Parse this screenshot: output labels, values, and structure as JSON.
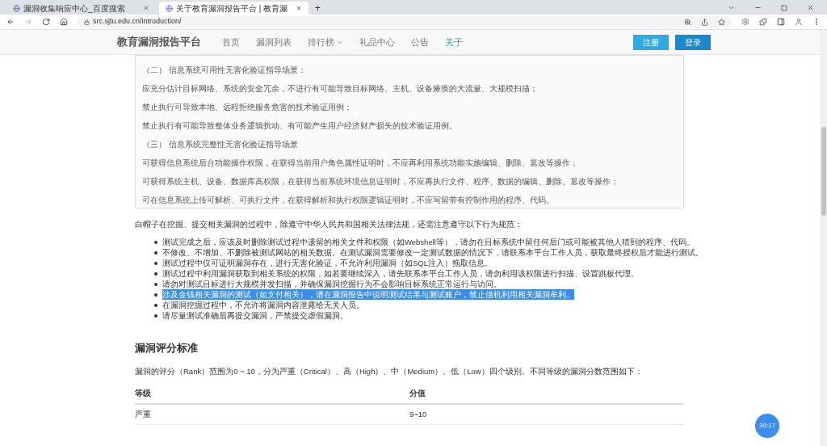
{
  "browser": {
    "tabs": [
      {
        "title": "漏洞收集响应中心_百度搜索",
        "selected": false
      },
      {
        "title": "关于教育漏洞报告平台 | 教育漏",
        "selected": true
      }
    ],
    "new_tab": "+",
    "url": "src.sjtu.edu.cn/introduction/"
  },
  "site_nav": {
    "brand": "教育漏洞报告平台",
    "items": [
      {
        "label": "首页",
        "selected": false,
        "dropdown": false
      },
      {
        "label": "漏洞列表",
        "selected": false,
        "dropdown": false
      },
      {
        "label": "排行榜",
        "selected": false,
        "dropdown": true
      },
      {
        "label": "礼品中心",
        "selected": false,
        "dropdown": false
      },
      {
        "label": "公告",
        "selected": false,
        "dropdown": false
      },
      {
        "label": "关于",
        "selected": true,
        "dropdown": false
      }
    ],
    "register": "注册",
    "login": "登录"
  },
  "document_image": {
    "lines": [
      "（二） 信息系统可用性无害化验证指导场景：",
      "应充分估计目标网络、系统的安全冗余，不进行有可能导致目标网络、主机、设备瘫痪的大流量、大规模扫描；",
      "禁止执行可导致本地、远程拒绝服务危害的技术验证用例；",
      "禁止执行有可能导致整体业务逻辑扰动、有可能产生用户经济财产损失的技术验证用例。",
      "（三） 信息系统完整性无害化验证指导场景",
      "可获得信息系统后台功能操作权限，在获得当前用户角色属性证明时，不应再利用系统功能实施编辑、删除、篡改等操作；",
      "可获得系统主机、设备、数据库高权限，在获得当前系统环境信息证明时，不应再执行文件、程序、数据的编辑、删除、篡改等操作；",
      "可在信息系统上传可解析、可执行文件，在获得解析和执行权限逻辑证明时，不应写留带有控制作用的程序、代码。"
    ]
  },
  "intro": "白帽子在挖掘、提交相关漏洞的过程中，除遵守中华人民共和国相关法律法规，还需注意遵守以下行为规范：",
  "rules": [
    {
      "text": "测试完成之后，应该及时删除测试过程中遗留的相关文件和权限（如Webshell等），请勿在目标系统中留任何后门或可能被其他人猜到的程序、代码。",
      "selected": false
    },
    {
      "text": "不修改、不增加、不删除被测试网站的相关数据。在测试漏洞需要修改一定测试数据的情况下，请联系本平台工作人员，获取最终授权后才能进行测试。",
      "selected": false
    },
    {
      "text": "测试过程中仅可证明漏洞存在，进行无害化验证，不允许利用漏洞（如SQL注入）拖取信息。",
      "selected": false
    },
    {
      "text": "测试过程中利用漏洞获取到相关系统的权限，如若要继续深入，请先联系本平台工作人员，请勿利用该权限进行扫描、设置跳板代理。",
      "selected": false
    },
    {
      "text": "请勿对测试目标进行大规模并发扫描，并确保漏洞挖掘行为不会影响目标系统正常运行与访问。",
      "selected": false
    },
    {
      "text": "涉及金钱相关漏洞的测试（如支付相关），请在漏洞报告中说明测试结果与测试账户，禁止借机利用相关漏洞牟利。",
      "selected": true
    },
    {
      "text": "在漏洞挖掘过程中，不允许将漏洞内容泄露给无关人员。",
      "selected": false
    },
    {
      "text": "请尽量测试准确后再提交漏洞，严禁提交虚假漏洞。",
      "selected": false
    }
  ],
  "section": {
    "heading": "漏洞评分标准",
    "description": "漏洞的评分（Rank）范围为0 ~ 10，分为严重（Critical）、高（High）、中（Medium）、低（Low）四个级别。不同等级的漏洞分数范围如下：",
    "table": {
      "columns": [
        "等级",
        "分值"
      ],
      "rows": [
        [
          "严重",
          "9~10"
        ]
      ]
    }
  },
  "timer": "30:17"
}
